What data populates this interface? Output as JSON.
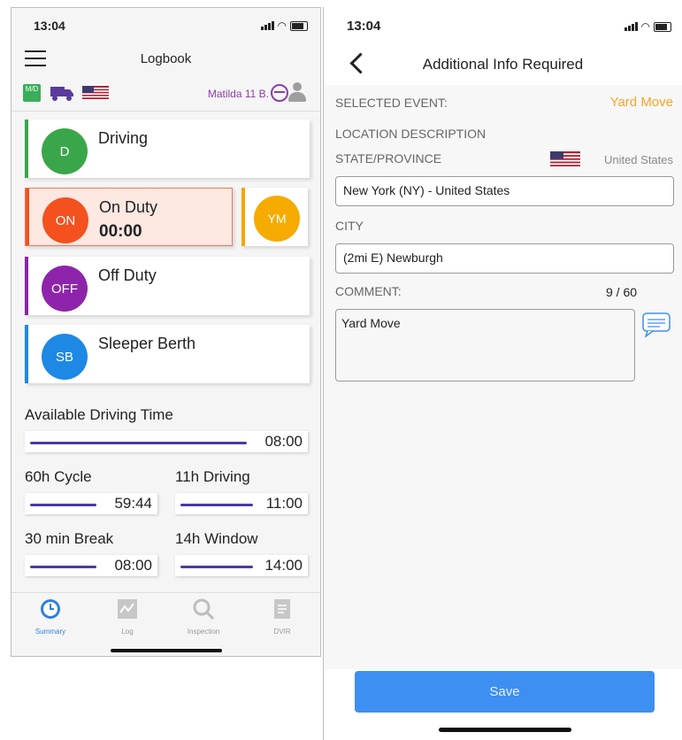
{
  "left": {
    "status_time": "13:04",
    "title": "Logbook",
    "md_badge": "M/D",
    "user": "Matilda 11 B.",
    "statuses": [
      {
        "code": "D",
        "label": "Driving",
        "time": "",
        "color": "#3aa64a",
        "bar": "#3aa64a"
      },
      {
        "code": "ON",
        "label": "On Duty",
        "time": "00:00",
        "color": "#f4511e",
        "bar": "#f4511e"
      },
      {
        "code": "OFF",
        "label": "Off Duty",
        "time": "",
        "color": "#8e24aa",
        "bar": "#8e24aa"
      },
      {
        "code": "SB",
        "label": "Sleeper Berth",
        "time": "",
        "color": "#1e88e5",
        "bar": "#1e88e5"
      }
    ],
    "ym_code": "YM",
    "available_label": "Available Driving Time",
    "available_value": "08:00",
    "meters": [
      {
        "label": "60h Cycle",
        "value": "59:44"
      },
      {
        "label": "11h Driving",
        "value": "11:00"
      },
      {
        "label": "30 min Break",
        "value": "08:00"
      },
      {
        "label": "14h Window",
        "value": "14:00"
      }
    ],
    "tabs": [
      {
        "label": "Summary",
        "icon": "clock-icon",
        "active": true
      },
      {
        "label": "Log",
        "icon": "chart-icon",
        "active": false
      },
      {
        "label": "Inspection",
        "icon": "magnifier-icon",
        "active": false
      },
      {
        "label": "DVIR",
        "icon": "document-icon",
        "active": false
      }
    ]
  },
  "right": {
    "status_time": "13:04",
    "title": "Additional Info Required",
    "selected_event_label": "SELECTED EVENT:",
    "selected_event_value": "Yard Move",
    "location_label": "LOCATION DESCRIPTION",
    "state_label": "STATE/PROVINCE",
    "country": "United States",
    "state_value": "New York (NY) - United States",
    "city_label": "CITY",
    "city_value": "(2mi E) Newburgh",
    "comment_label": "COMMENT:",
    "comment_count": "9 / 60",
    "comment_value": "Yard Move",
    "save_label": "Save"
  },
  "colors": {
    "accent": "#3d8ff2",
    "orange": "#f5a623",
    "purple_line": "#4a3aa0"
  }
}
